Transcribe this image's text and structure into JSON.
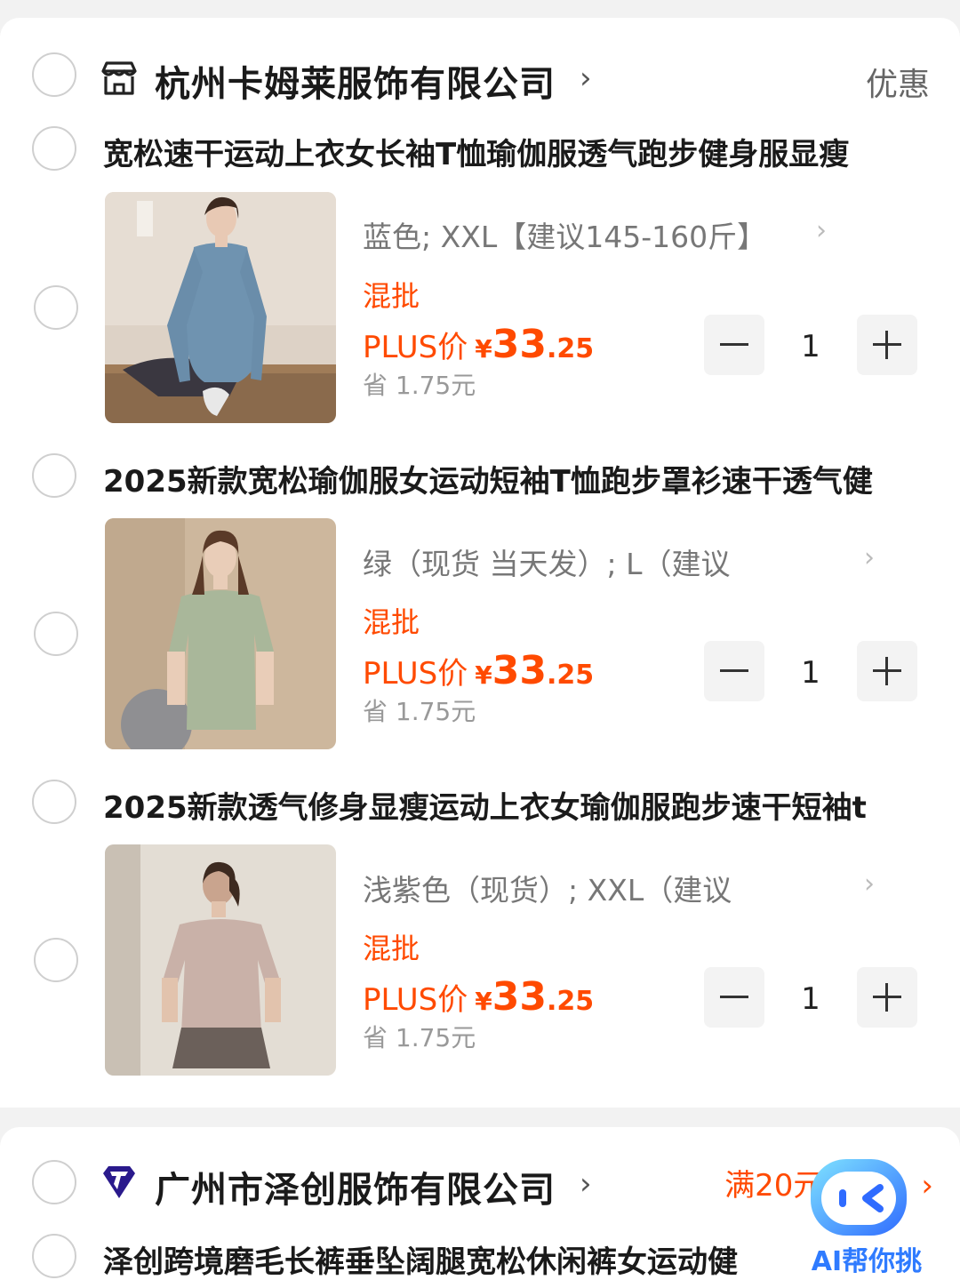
{
  "shops": [
    {
      "name": "杭州卡姆莱服饰有限公司",
      "chevron": "›",
      "right_label": "优惠",
      "items": [
        {
          "title": "宽松速干运动上衣女长袖T恤瑜伽服透气跑步健身服显瘦",
          "spec": "蓝色; XXL【建议145-160斤】",
          "spec_chevron": "›",
          "tag": "混批",
          "plus_label": "PLUS价",
          "currency": "¥",
          "price_int": "33",
          "price_dec": ".25",
          "save_text": "省 1.75元",
          "qty": "1"
        },
        {
          "title": "2025新款宽松瑜伽服女运动短袖T恤跑步罩衫速干透气健",
          "spec": "绿（现货 当天发）; L（建议",
          "spec_chevron": "›",
          "tag": "混批",
          "plus_label": "PLUS价",
          "currency": "¥",
          "price_int": "33",
          "price_dec": ".25",
          "save_text": "省 1.75元",
          "qty": "1"
        },
        {
          "title": "2025新款透气修身显瘦运动上衣女瑜伽服跑步速干短袖t",
          "spec": "浅紫色（现货）; XXL（建议",
          "spec_chevron": "›",
          "tag": "混批",
          "plus_label": "PLUS价",
          "currency": "¥",
          "price_int": "33",
          "price_dec": ".25",
          "save_text": "省 1.75元",
          "qty": "1"
        }
      ]
    },
    {
      "name": "广州市泽创服饰有限公司",
      "chevron": "›",
      "promo": "满20元",
      "promo_chevron": "›",
      "items": [
        {
          "title": "泽创跨境磨毛长裤垂坠阔腿宽松休闲裤女运动健"
        }
      ]
    }
  ],
  "ai_assistant": {
    "label": "AI帮你挑"
  },
  "colors": {
    "accent": "#ff4a00",
    "ai_blue": "#2f7bff"
  },
  "icons": [
    "store-icon",
    "brand-diamond-icon",
    "minus-icon",
    "plus-icon",
    "ai-assistant-icon"
  ]
}
